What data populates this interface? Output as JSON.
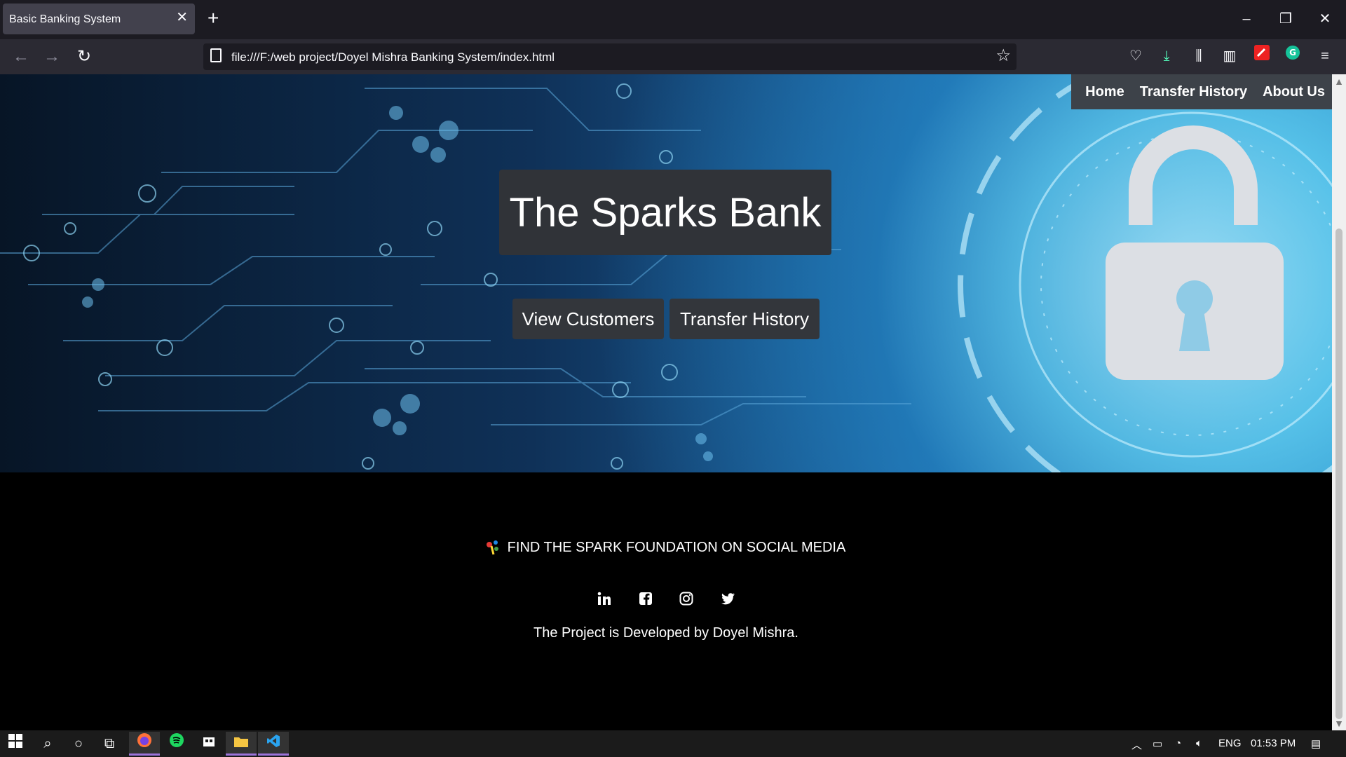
{
  "browser": {
    "tab_title": "Basic Banking System",
    "url": "file:///F:/web project/Doyel Mishra Banking System/index.html"
  },
  "nav": {
    "items": [
      {
        "label": "Home"
      },
      {
        "label": "Transfer History"
      },
      {
        "label": "About Us"
      }
    ]
  },
  "hero": {
    "title": "The Sparks Bank",
    "buttons": [
      {
        "label": "View Customers"
      },
      {
        "label": "Transfer History"
      }
    ]
  },
  "footer": {
    "social_heading": "FIND THE SPARK FOUNDATION ON SOCIAL MEDIA",
    "social_icons": [
      "linkedin-icon",
      "facebook-icon",
      "instagram-icon",
      "twitter-icon"
    ],
    "credit": "The Project is Developed by Doyel Mishra."
  },
  "taskbar": {
    "language": "ENG",
    "time": "01:53 PM"
  }
}
